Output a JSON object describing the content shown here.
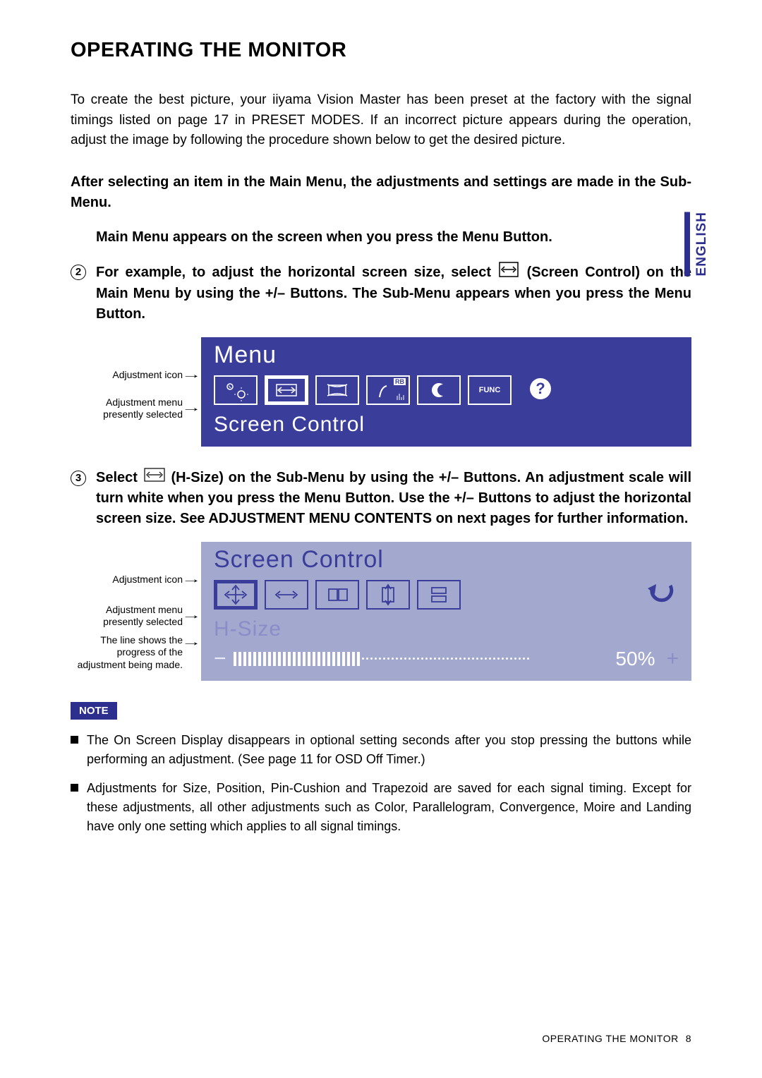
{
  "language_tab": "ENGLISH",
  "title": "OPERATING THE MONITOR",
  "intro": "To create the best picture, your iiyama Vision Master has been preset at the factory with the signal timings listed on page 17 in PRESET MODES. If an incorrect picture appears during the operation, adjust the image by following the procedure shown below to get the desired picture.",
  "bold_intro": "After selecting an item in the Main Menu, the adjustments and settings are made in the Sub-Menu.",
  "step1": "Main Menu appears on the screen when you press the Menu Button.",
  "step2_a": "For example, to adjust the horizontal screen size, select ",
  "step2_b": " (Screen Control) on the Main Menu by using the +/– Buttons. The Sub-Menu appears when you press the Menu Button.",
  "step3_a": "Select ",
  "step3_b": "(H-Size) on the Sub-Menu by using the +/– Buttons. An adjustment scale will turn white when you press the Menu Button. Use the +/– Buttons to adjust the horizontal screen size. See ADJUSTMENT MENU CONTENTS on next pages for further information.",
  "labels": {
    "adj_icon": "Adjustment icon",
    "adj_menu": "Adjustment menu presently selected",
    "progress_line": "The line shows the progress of the adjustment being made."
  },
  "osd1": {
    "title": "Menu",
    "sub": "Screen Control",
    "func_label": "FUNC",
    "rb_label": "RB"
  },
  "osd2": {
    "title": "Screen Control",
    "sub": "H-Size",
    "percent": "50%",
    "minus": "−",
    "plus": "+"
  },
  "note_badge": "NOTE",
  "notes": [
    "The On Screen Display disappears in optional setting seconds after you stop pressing the buttons while performing an adjustment. (See page 11 for OSD Off Timer.)",
    "Adjustments for Size, Position, Pin-Cushion and Trapezoid are saved for each signal timing. Except for these adjustments, all other adjustments such as Color, Parallelogram, Convergence, Moire and Landing have only one setting which applies to all signal timings."
  ],
  "footer_text": "OPERATING THE MONITOR",
  "footer_page": "8",
  "step_numbers": {
    "s2": "2",
    "s3": "3"
  }
}
